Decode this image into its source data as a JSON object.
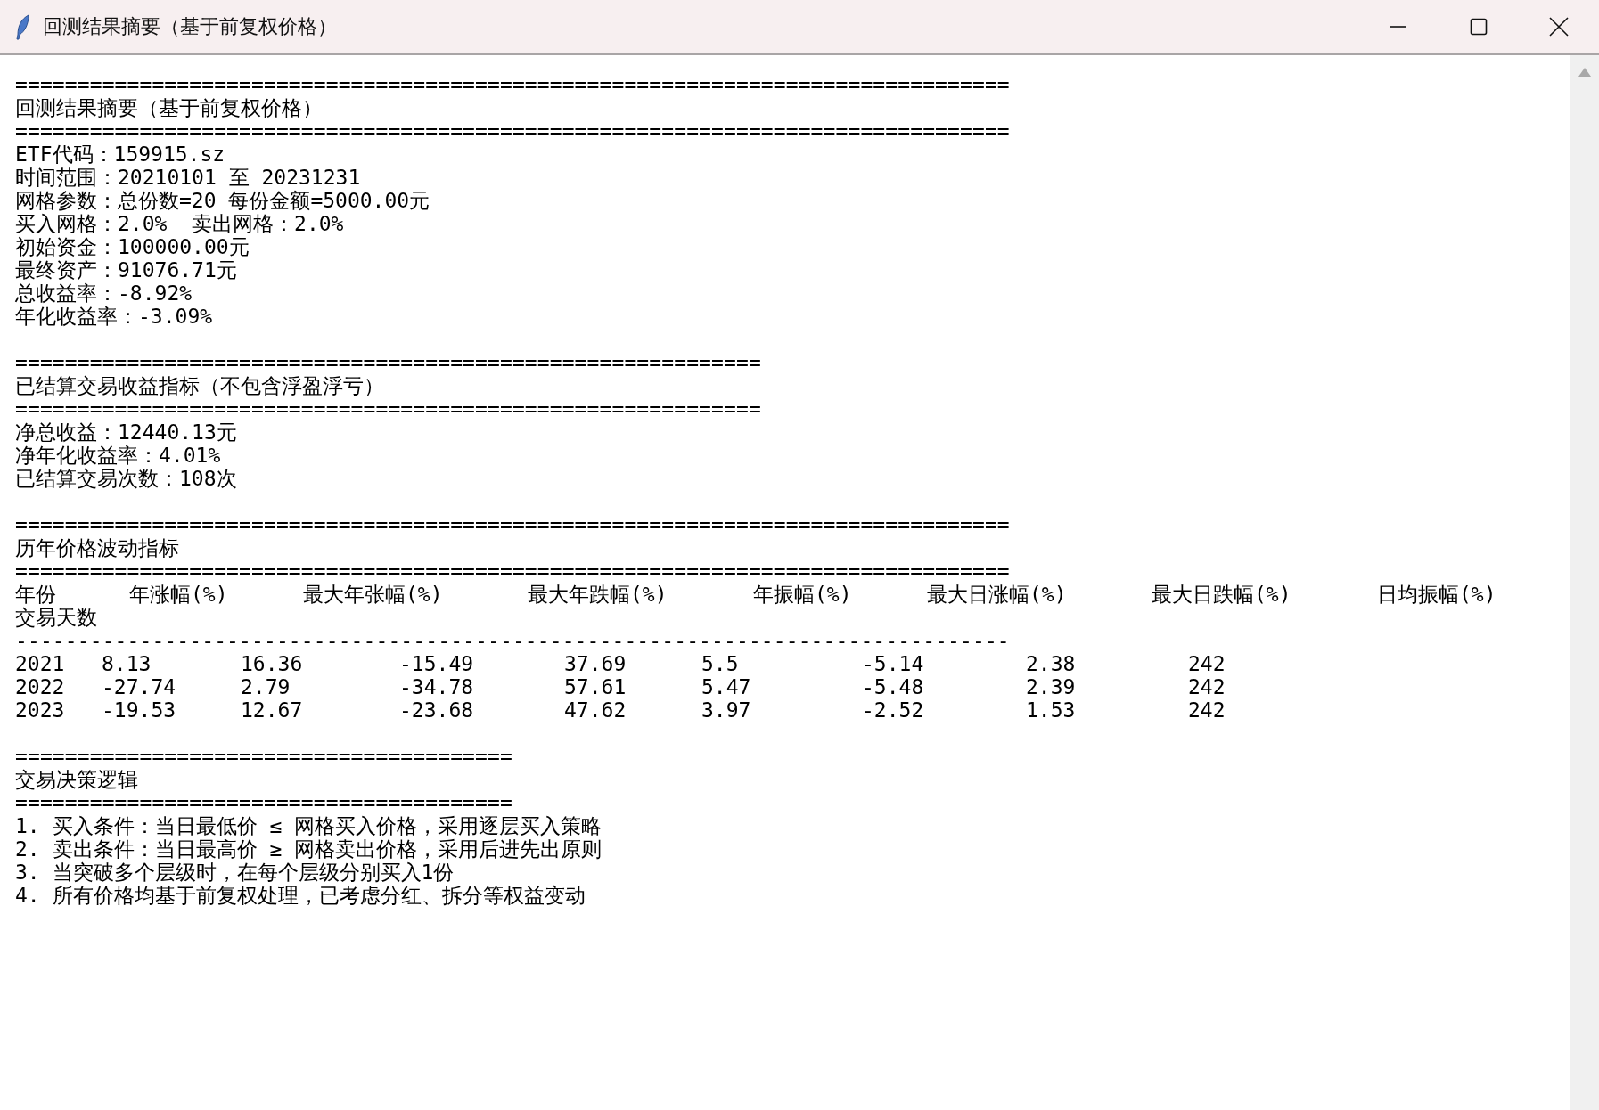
{
  "window": {
    "title": "回测结果摘要（基于前复权价格）"
  },
  "sections": [
    {
      "kind": "text",
      "rule_top": "================================================================================",
      "heading": "回测结果摘要（基于前复权价格）",
      "rule_bottom": "================================================================================",
      "lines": [
        "ETF代码：159915.sz",
        "时间范围：20210101 至 20231231",
        "网格参数：总份数=20 每份金额=5000.00元",
        "买入网格：2.0%  卖出网格：2.0%",
        "初始资金：100000.00元",
        "最终资产：91076.71元",
        "总收益率：-8.92%",
        "年化收益率：-3.09%"
      ]
    },
    {
      "kind": "text",
      "rule_top": "============================================================",
      "heading": "已结算交易收益指标（不包含浮盈浮亏）",
      "rule_bottom": "============================================================",
      "lines": [
        "净总收益：12440.13元",
        "净年化收益率：4.01%",
        "已结算交易次数：108次"
      ]
    },
    {
      "kind": "listing",
      "rule_top": "================================================================================",
      "heading": "历年价格波动指标",
      "rule_bottom": "================================================================================",
      "listing": {
        "header_words": [
          "年份",
          "年涨幅(%)",
          "最大年张幅(%)",
          "最大年跌幅(%)",
          "年振幅(%)",
          "最大日涨幅(%)",
          "最大日跌幅(%)",
          "日均振幅(%)",
          "交易天数"
        ],
        "divider": "--------------------------------------------------------------------------------",
        "printed_lines": [
          [
            "2021",
            "8.13",
            "16.36",
            "-15.49",
            "37.69",
            "5.5",
            "-5.14",
            "2.38",
            "242"
          ],
          [
            "2022",
            "-27.74",
            "2.79",
            "-34.78",
            "57.61",
            "5.47",
            "-5.48",
            "2.39",
            "242"
          ],
          [
            "2023",
            "-19.53",
            "12.67",
            "-23.68",
            "47.62",
            "3.97",
            "-2.52",
            "1.53",
            "242"
          ]
        ]
      }
    },
    {
      "kind": "text",
      "rule_top": "========================================",
      "heading": "交易决策逻辑",
      "rule_bottom": "========================================",
      "lines": [
        "1. 买入条件：当日最低价 ≤ 网格买入价格，采用逐层买入策略",
        "2. 卖出条件：当日最高价 ≥ 网格卖出价格，采用后进先出原则",
        "3. 当突破多个层级时，在每个层级分别买入1份",
        "4. 所有价格均基于前复权处理，已考虑分红、拆分等权益变动"
      ]
    }
  ]
}
